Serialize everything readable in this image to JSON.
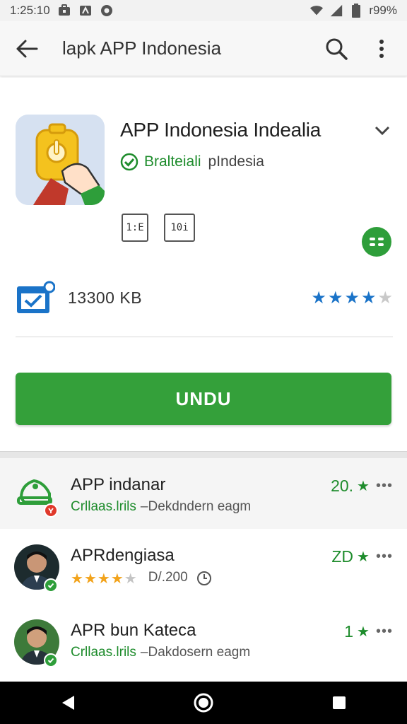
{
  "status_bar": {
    "time": "1:25:10",
    "battery": "r99%"
  },
  "app_bar": {
    "search_text": "lapk APP Indonesia"
  },
  "detail": {
    "title": "APP Indonesia Indealia",
    "developer": "Bralteiali",
    "location": "pIndesia",
    "badges": [
      "1:E",
      "10i"
    ],
    "downloads": "13300 KB",
    "rating_stars": 4,
    "install_label": "UNDU"
  },
  "list": [
    {
      "title": "APP indanar",
      "sub_green": "Crllaas.lrils",
      "sub_gray": "–Dekdndern eagm",
      "rating": "20.",
      "avatar": "app-icon"
    },
    {
      "title": "APRdengiasa",
      "stars": 3.5,
      "sub_gray": "D/.200",
      "rating": "ZD",
      "avatar": "person-photo"
    },
    {
      "title": "APR bun Kateca",
      "sub_green": "Crllaas.lrils",
      "sub_gray": "–Dakdosern eagm",
      "rating": "1",
      "avatar": "person-photo"
    }
  ],
  "colors": {
    "accent_green": "#34a03a",
    "star_blue": "#1a73c8",
    "star_gold": "#f2a31b"
  }
}
